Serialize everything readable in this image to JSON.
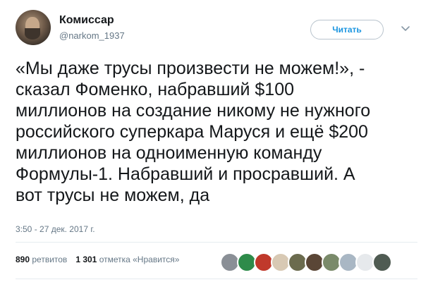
{
  "author": {
    "display_name": "Комиссар",
    "handle": "@narkom_1937"
  },
  "follow_button": {
    "label": "Читать"
  },
  "tweet": {
    "text": "«Мы даже трусы произвести не можем!», -\nсказал Фоменко, набравший $100\nмиллионов на создание никому не нужного\nроссийского суперкара Маруся и ещё $200\nмиллионов на одноименную команду\nФормулы-1. Набравший и просравший. А\nвот трусы не можем, да",
    "timestamp": "3:50 - 27 дек. 2017 г."
  },
  "stats": {
    "retweets_count": "890",
    "retweets_label": "ретвитов",
    "likes_count": "1 301",
    "likes_label": "отметка «Нравится»"
  },
  "likers": [
    {
      "name": "liker-avatar-1",
      "color": "#8a8f96"
    },
    {
      "name": "liker-avatar-2",
      "color": "#2e8b4a"
    },
    {
      "name": "liker-avatar-3",
      "color": "#c0392b"
    },
    {
      "name": "liker-avatar-4",
      "color": "#d8c9b4"
    },
    {
      "name": "liker-avatar-5",
      "color": "#6b6b4e"
    },
    {
      "name": "liker-avatar-6",
      "color": "#5a4636"
    },
    {
      "name": "liker-avatar-7",
      "color": "#7a8a6a"
    },
    {
      "name": "liker-avatar-8",
      "color": "#a9b7c4"
    },
    {
      "name": "liker-avatar-9",
      "color": "#e6e9ec"
    },
    {
      "name": "liker-avatar-10",
      "color": "#4f5b52"
    }
  ]
}
